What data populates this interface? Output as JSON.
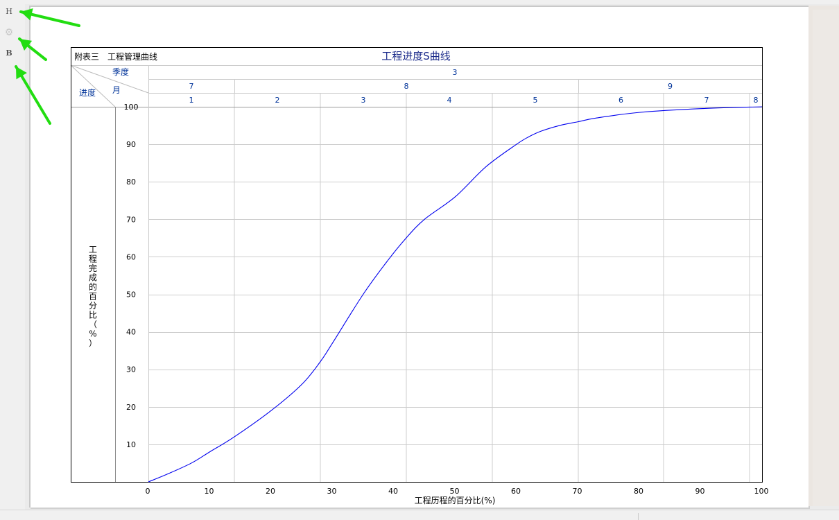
{
  "toolbar": {
    "h_label": "H",
    "gear_icon": "gear-icon",
    "b_label": "B",
    "arrow_color": "#22dd11"
  },
  "colors": {
    "curve": "#0000ee",
    "header_text": "#003399",
    "title_text": "#1a2a8a",
    "grid": "#cccccc",
    "border": "#000000"
  },
  "header": {
    "corner_label": "附表三　工程管理曲线",
    "quarter_label": "季度",
    "month_label": "月",
    "progress_label": "进度",
    "quarter_value": "3",
    "month_cells": [
      "7",
      "8",
      "9"
    ],
    "week_cells": [
      "1",
      "2",
      "3",
      "4",
      "5",
      "6",
      "7",
      "8"
    ]
  },
  "chart_data": {
    "type": "line",
    "title": "工程进度S曲线",
    "xlabel": "工程历程的百分比(%)",
    "ylabel": "工程完成的百分比（%）",
    "xlim": [
      0,
      100
    ],
    "ylim": [
      0,
      100
    ],
    "x_ticks": [
      0,
      10,
      20,
      30,
      40,
      50,
      60,
      70,
      80,
      90,
      100
    ],
    "y_ticks": [
      10,
      20,
      30,
      40,
      50,
      60,
      70,
      80,
      90,
      100
    ],
    "grid": true,
    "series": [
      {
        "x": [
          0,
          3,
          7,
          10,
          14,
          20,
          25,
          28,
          30,
          35,
          39,
          42,
          45,
          50,
          55,
          60,
          62,
          64,
          67,
          70,
          73,
          80,
          90,
          100
        ],
        "y": [
          0,
          2,
          5,
          8,
          12,
          19,
          26,
          32,
          37,
          50,
          59,
          65,
          70,
          76,
          84,
          90,
          92,
          93.5,
          95,
          96,
          97,
          98.5,
          99.5,
          100
        ]
      }
    ]
  }
}
